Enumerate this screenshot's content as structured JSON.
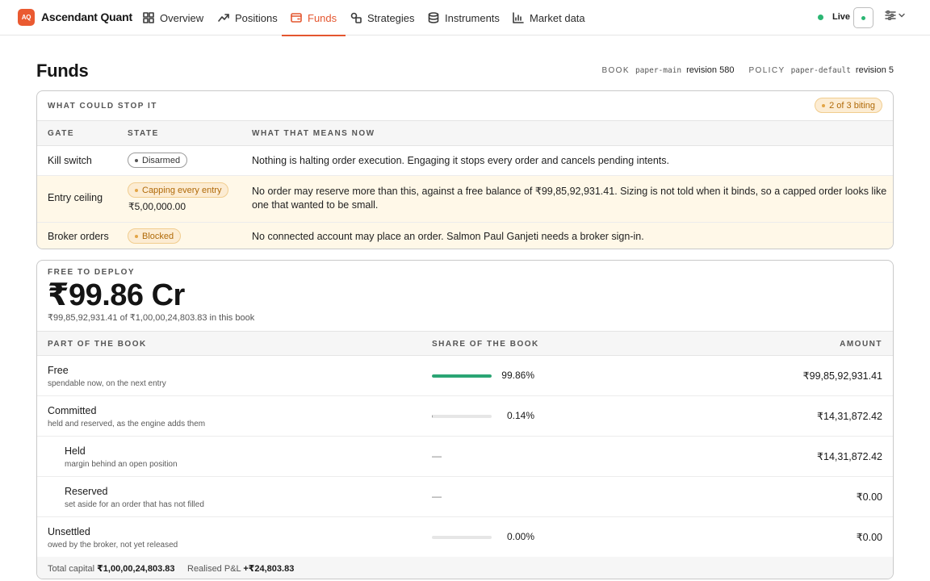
{
  "brand": {
    "logo_text": "AQ",
    "name": "Ascendant Quant",
    "accent_color": "#e4562f"
  },
  "nav": [
    {
      "label": "Overview",
      "icon": "grid-icon",
      "active": false
    },
    {
      "label": "Positions",
      "icon": "trend-icon",
      "active": false
    },
    {
      "label": "Funds",
      "icon": "wallet-icon",
      "active": true
    },
    {
      "label": "Strategies",
      "icon": "shapes-icon",
      "active": false
    },
    {
      "label": "Instruments",
      "icon": "database-icon",
      "active": false
    },
    {
      "label": "Market data",
      "icon": "bar-chart-icon",
      "active": false
    }
  ],
  "status": {
    "label": "Live",
    "color": "#2bb673"
  },
  "page": {
    "title": "Funds",
    "book_key": "BOOK",
    "book_value": "paper-main",
    "book_revision": "revision 580",
    "policy_key": "POLICY",
    "policy_value": "paper-default",
    "policy_revision": "revision 5"
  },
  "gates": {
    "heading": "WHAT COULD STOP IT",
    "badge": "2 of 3 biting",
    "columns": [
      "GATE",
      "STATE",
      "WHAT THAT MEANS NOW"
    ],
    "rows": [
      {
        "name": "Kill switch",
        "state": "Disarmed",
        "tone": "neutral",
        "state_value": "",
        "meaning": "Nothing is halting order execution. Engaging it stops every order and cancels pending intents."
      },
      {
        "name": "Entry ceiling",
        "state": "Capping every entry",
        "tone": "warn",
        "state_value": "₹5,00,000.00",
        "meaning": "No order may reserve more than this, against a free balance of ₹99,85,92,931.41. Sizing is not told when it binds, so a capped order looks like one that wanted to be small."
      },
      {
        "name": "Broker orders",
        "state": "Blocked",
        "tone": "warn",
        "state_value": "",
        "meaning": "No connected account may place an order. Salmon Paul Ganjeti needs a broker sign-in."
      }
    ]
  },
  "funds": {
    "label": "FREE TO DEPLOY",
    "headline": "₹99.86 Cr",
    "subline": "₹99,85,92,931.41 of ₹1,00,00,24,803.83 in this book",
    "columns": [
      "PART OF THE BOOK",
      "SHARE OF THE BOOK",
      "AMOUNT"
    ],
    "rows": [
      {
        "title": "Free",
        "desc": "spendable now, on the next entry",
        "share": 99.86,
        "share_label": "99.86%",
        "amount": "₹99,85,92,931.41",
        "indent": false,
        "bar_color": "#2aa574"
      },
      {
        "title": "Committed",
        "desc": "held and reserved, as the engine adds them",
        "share": 0.14,
        "share_label": "0.14%",
        "amount": "₹14,31,872.42",
        "indent": false,
        "bar_color": "#9a9a9a"
      },
      {
        "title": "Held",
        "desc": "margin behind an open position",
        "share": null,
        "share_label": "—",
        "amount": "₹14,31,872.42",
        "indent": true
      },
      {
        "title": "Reserved",
        "desc": "set aside for an order that has not filled",
        "share": null,
        "share_label": "—",
        "amount": "₹0.00",
        "indent": true
      },
      {
        "title": "Unsettled",
        "desc": "owed by the broker, not yet released",
        "share": 0.0,
        "share_label": "0.00%",
        "amount": "₹0.00",
        "indent": false,
        "bar_color": "#9a9a9a"
      }
    ],
    "footer": {
      "total_label": "Total capital",
      "total_value": "₹1,00,00,24,803.83",
      "pnl_label": "Realised P&L",
      "pnl_value": "+₹24,803.83"
    }
  }
}
